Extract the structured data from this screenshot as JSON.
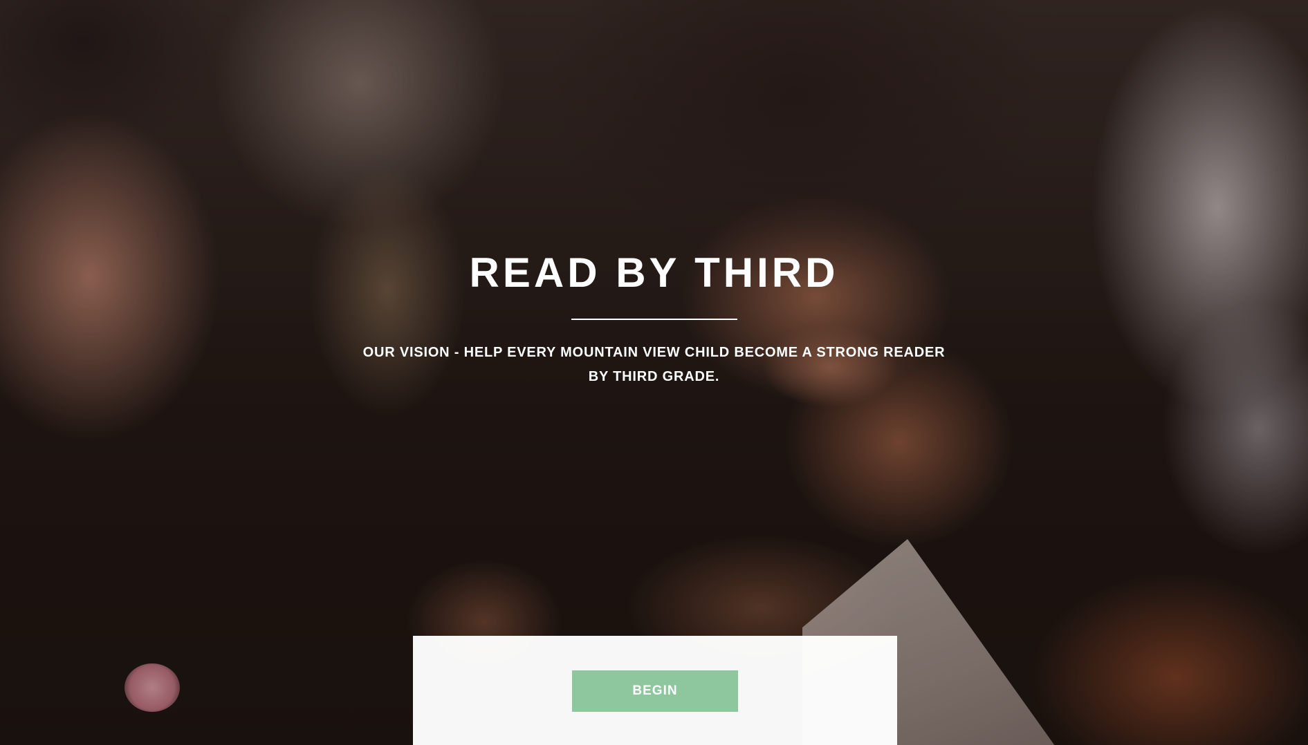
{
  "hero": {
    "title": "READ BY THIRD",
    "subtitle": "OUR VISION - HELP EVERY MOUNTAIN VIEW CHILD BECOME A STRONG READER BY THIRD GRADE."
  },
  "cta": {
    "begin_label": "BEGIN"
  },
  "colors": {
    "button_green": "#8ec79e",
    "panel_white": "#ffffff",
    "title_text": "#ffffff"
  }
}
